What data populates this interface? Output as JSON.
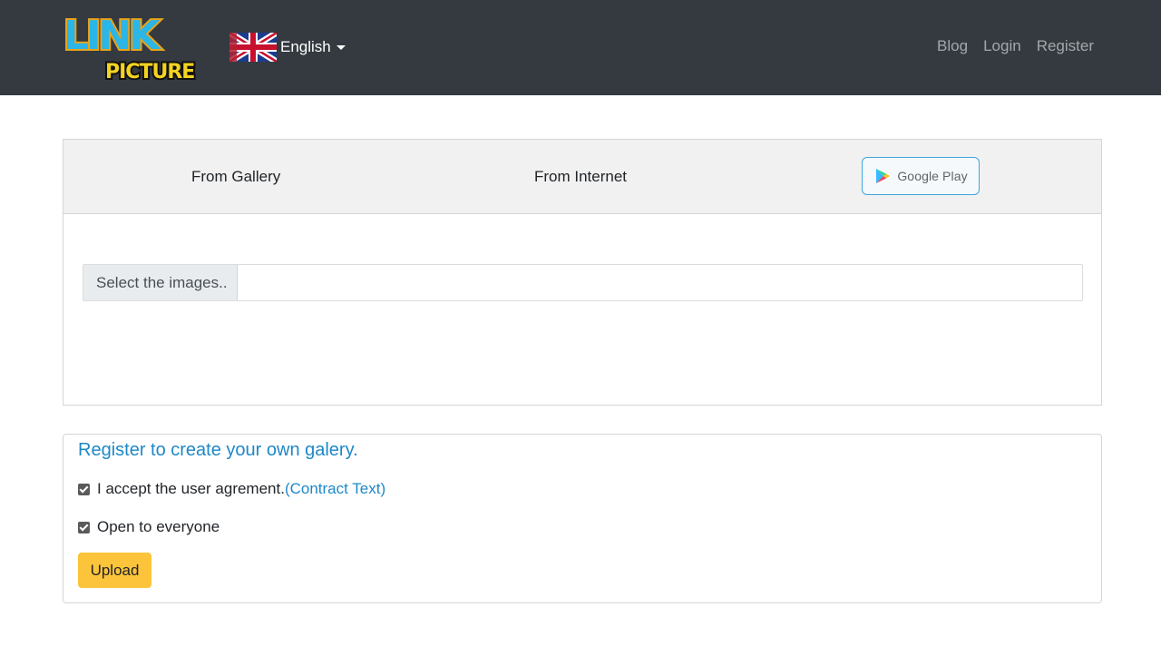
{
  "navbar": {
    "logo_text_top": "LINK",
    "logo_text_bottom": "PICTURE",
    "language": "English",
    "links": [
      "Blog",
      "Login",
      "Register"
    ]
  },
  "upload": {
    "tabs": [
      "From Gallery",
      "From Internet"
    ],
    "google_play_label": "Google Play",
    "file_button_label": "Select the images.."
  },
  "options": {
    "register_link": "Register to create your own galery.",
    "agreement_label": "I accept the user agrement.",
    "contract_link": "(Contract Text)",
    "open_label": "Open to everyone",
    "agreement_checked": true,
    "open_checked": true,
    "upload_button": "Upload"
  },
  "colors": {
    "navbar_bg": "#343a40",
    "link_blue": "#1e88c7",
    "upload_yellow": "#fcc43a",
    "google_play_border": "#3ea7dd"
  }
}
